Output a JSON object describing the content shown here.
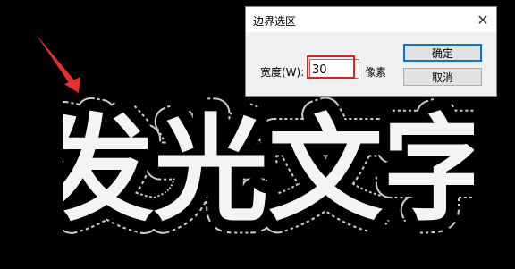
{
  "canvas": {
    "glow_text": "发光文字",
    "text_color": "#f5f4f4",
    "outline_color": "#000000",
    "selection_color": "#cccccc",
    "arrow_color": "#e8302a"
  },
  "dialog": {
    "title": "边界选区",
    "close_label": "✕",
    "width_label": "宽度(W):",
    "width_value": "30",
    "unit_label": "像素",
    "ok_label": "确定",
    "cancel_label": "取消",
    "highlight_color": "#e02020"
  }
}
